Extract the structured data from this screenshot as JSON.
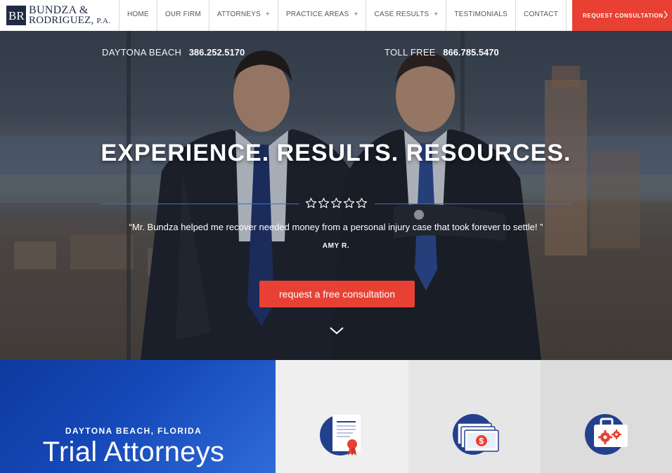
{
  "logo": {
    "mark": "BR",
    "line1": "BUNDZA &",
    "line2": "RODRIGUEZ,",
    "line2_suffix": "P.A."
  },
  "nav": {
    "items": [
      {
        "label": "HOME",
        "has_submenu": false
      },
      {
        "label": "OUR FIRM",
        "has_submenu": false
      },
      {
        "label": "ATTORNEYS",
        "has_submenu": true
      },
      {
        "label": "PRACTICE AREAS",
        "has_submenu": true
      },
      {
        "label": "CASE RESULTS",
        "has_submenu": true
      },
      {
        "label": "TESTIMONIALS",
        "has_submenu": false
      },
      {
        "label": "CONTACT",
        "has_submenu": false
      }
    ],
    "submenu_glyph": "+",
    "cta_label": "REQUEST CONSULTATION"
  },
  "hero": {
    "phone_left": {
      "label": "DAYTONA BEACH",
      "number": "386.252.5170"
    },
    "phone_right": {
      "label": "TOLL FREE",
      "number": "866.785.5470"
    },
    "headline": "EXPERIENCE. RESULTS. RESOURCES.",
    "rating_stars": 5,
    "quote": "“Mr. Bundza helped me recover needed money from a personal injury case that took forever to settle! ”",
    "author": "AMY R.",
    "button_label": "request a free consultation"
  },
  "bottom": {
    "subtitle": "DAYTONA BEACH, FLORIDA",
    "title": "Trial Attorneys",
    "panels": [
      {
        "icon": "certificate-icon"
      },
      {
        "icon": "money-icon"
      },
      {
        "icon": "briefcase-gears-icon"
      }
    ]
  },
  "colors": {
    "accent_red": "#e84134",
    "navy": "#1f2a44",
    "icon_blue": "#23408e",
    "divider_blue": "#3f6fc4"
  }
}
